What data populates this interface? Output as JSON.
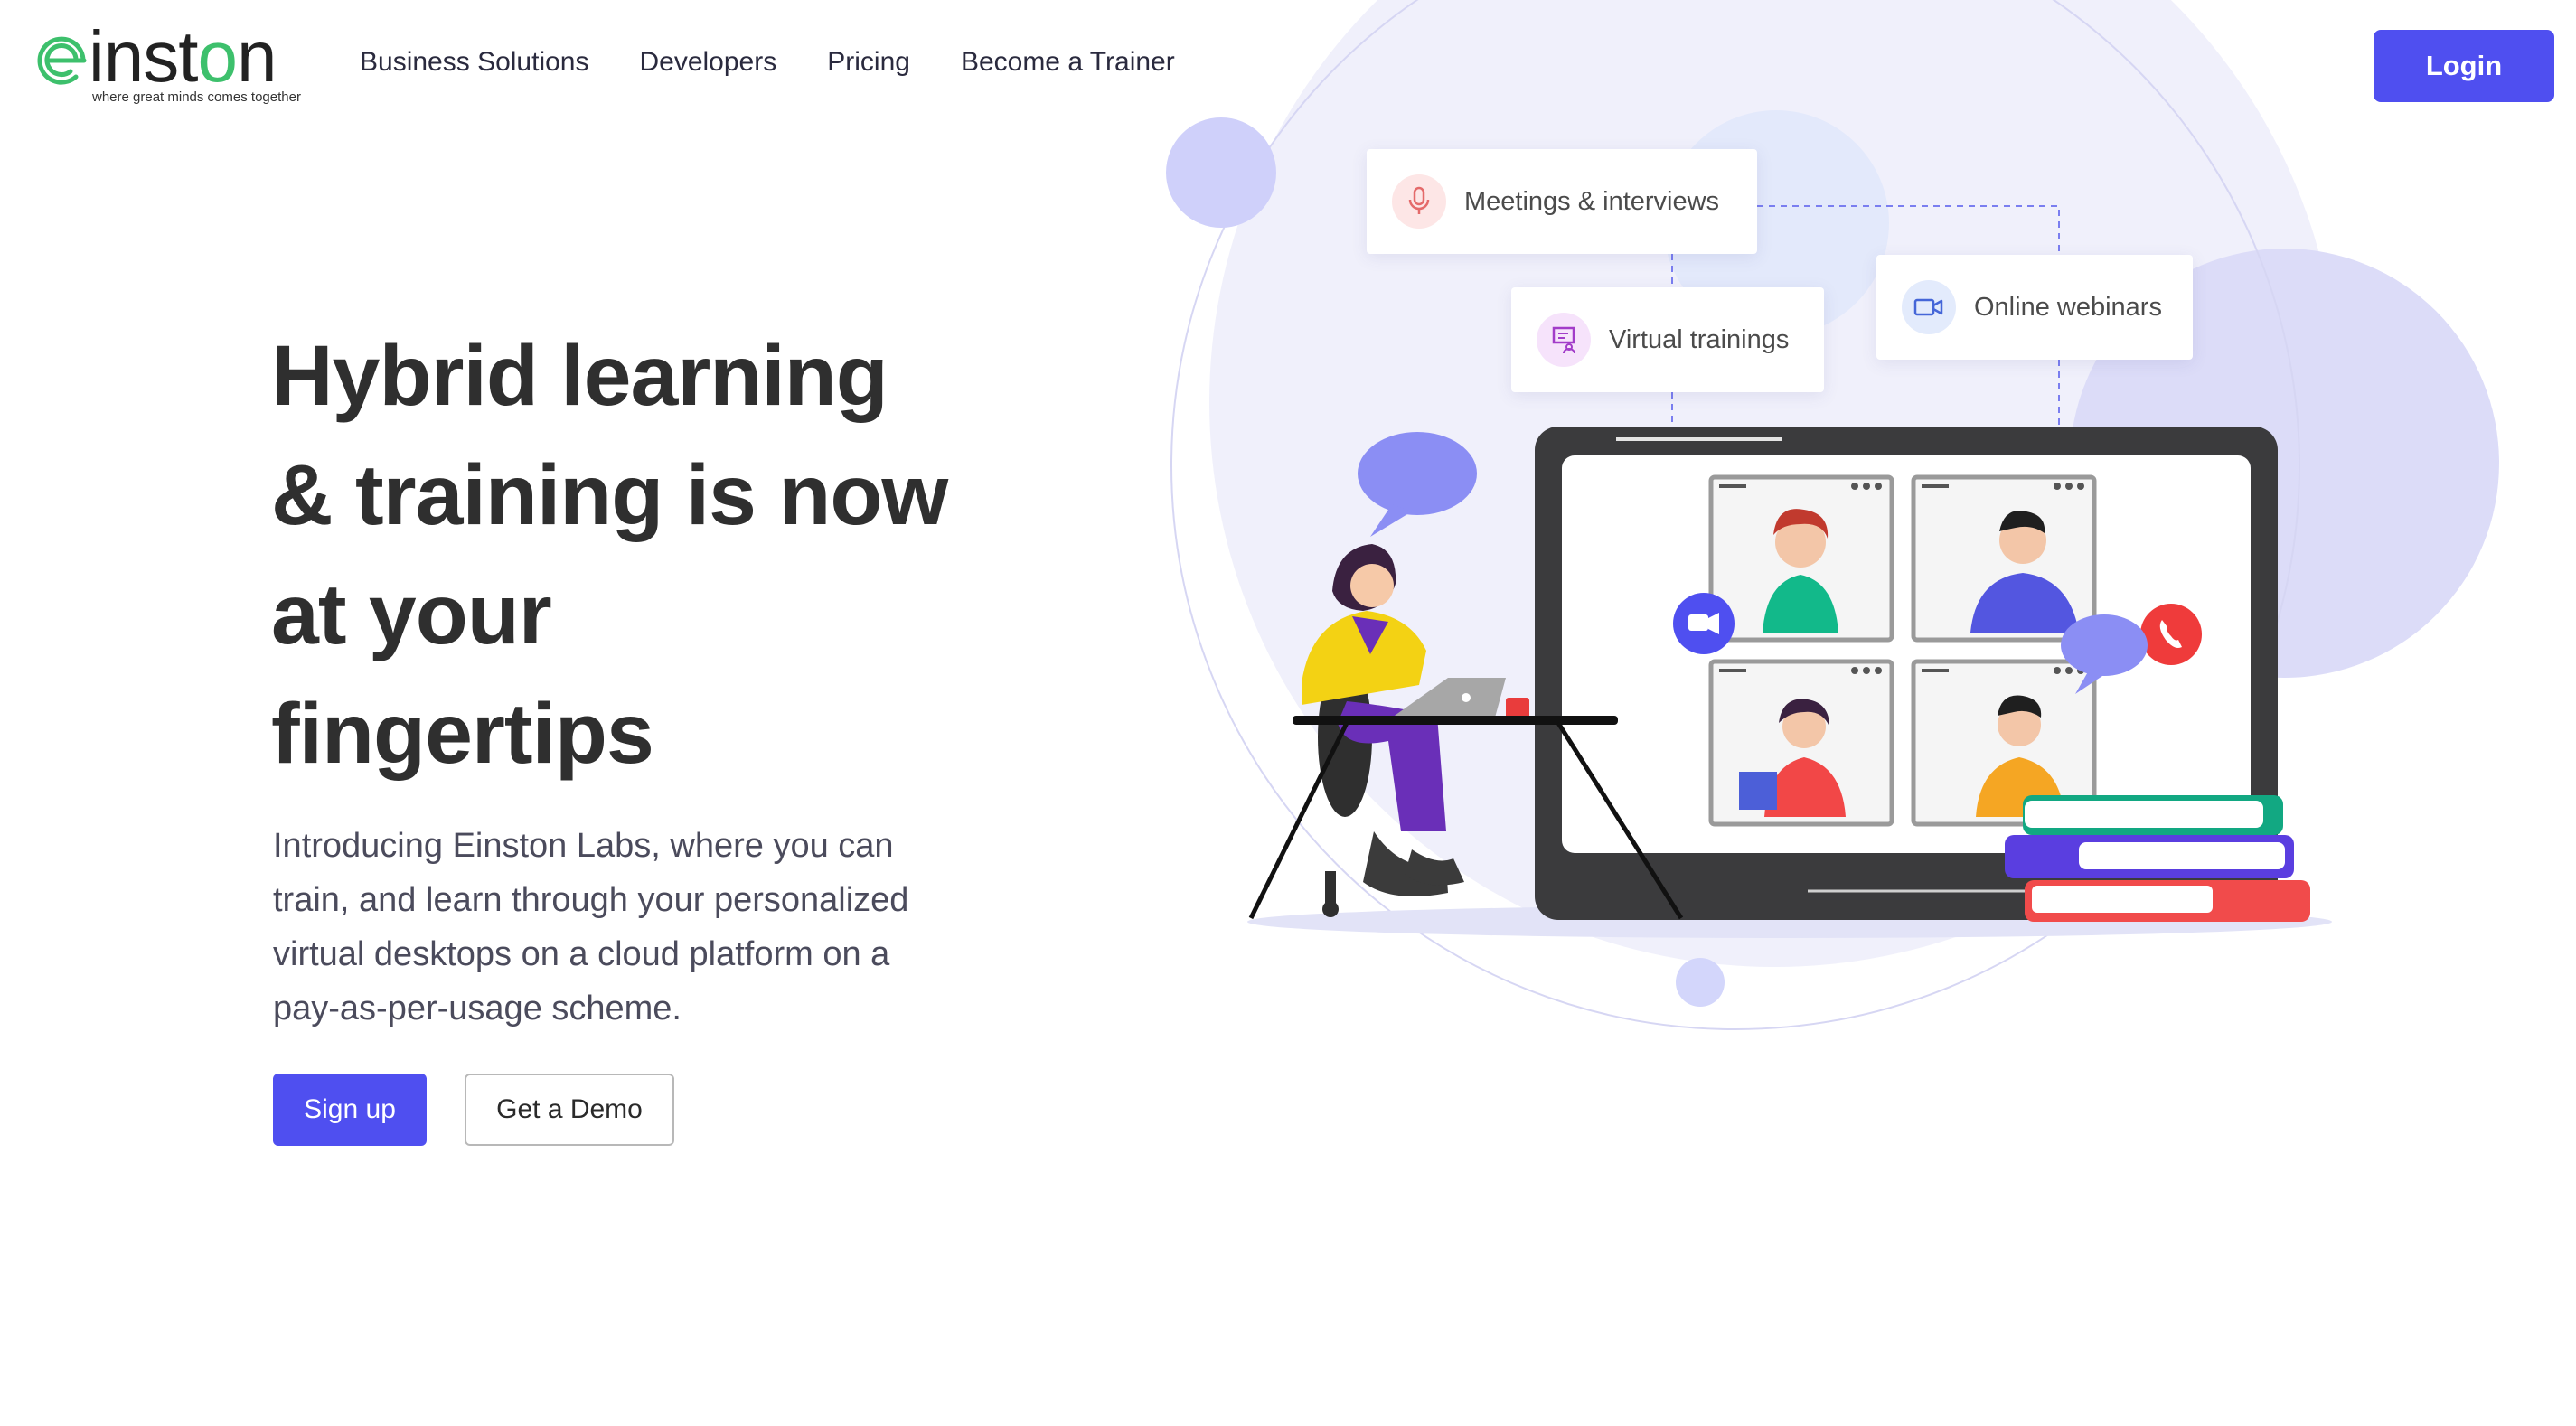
{
  "brand": {
    "name_prefix": "inst",
    "name_o": "o",
    "name_suffix": "n",
    "tagline": "where great minds comes together",
    "accent_color": "#4f4ff0",
    "logo_green": "#3dc06c"
  },
  "nav": {
    "items": [
      {
        "label": "Business Solutions"
      },
      {
        "label": "Developers"
      },
      {
        "label": "Pricing"
      },
      {
        "label": "Become a Trainer"
      }
    ],
    "login_label": "Login"
  },
  "hero": {
    "title_lines": [
      "Hybrid learning",
      "& training is now",
      "at your",
      "fingertips"
    ],
    "description_lines": [
      "Introducing Einston Labs, where you can",
      "train, and learn through your personalized",
      "virtual desktops on a cloud platform on a",
      "pay-as-per-usage scheme."
    ],
    "signup_label": "Sign up",
    "demo_label": "Get a Demo"
  },
  "features": {
    "meetings": {
      "label": "Meetings & interviews",
      "icon": "microphone-icon"
    },
    "trainings": {
      "label": "Virtual trainings",
      "icon": "presentation-icon"
    },
    "webinars": {
      "label": "Online webinars",
      "icon": "video-camera-icon"
    }
  }
}
